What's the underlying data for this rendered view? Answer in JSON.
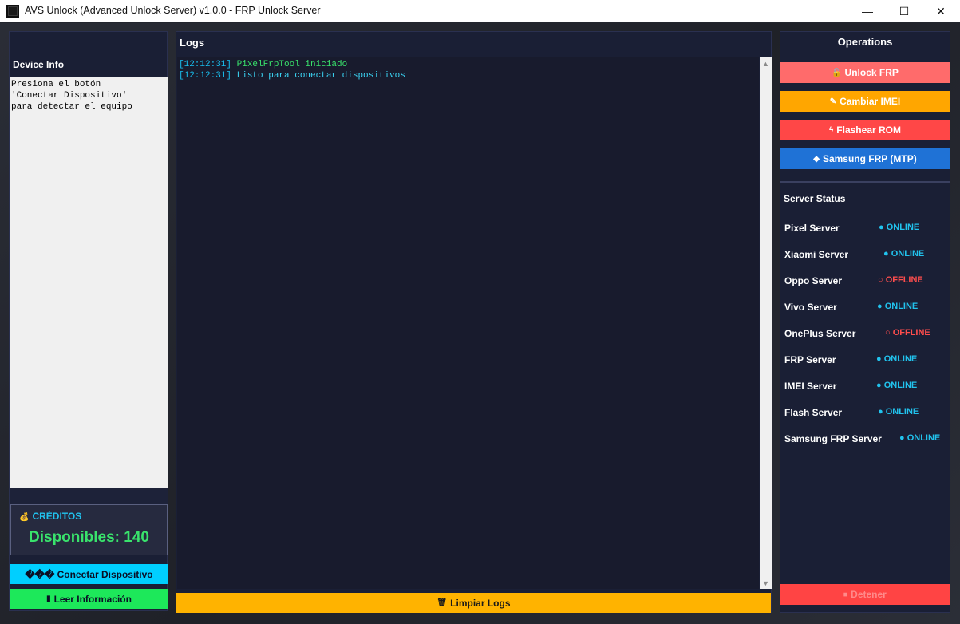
{
  "window": {
    "title": "AVS Unlock (Advanced Unlock Server) v1.0.0 - FRP Unlock Server",
    "minimize": "—",
    "maximize": "☐",
    "close": "✕"
  },
  "left": {
    "device_info_label": "Device Info",
    "device_text": "Presiona el botón\n'Conectar Dispositivo'\npara detectar el equipo",
    "credits_label": "CRÉDITOS",
    "credits_icon": "💰",
    "credits_value": "Disponibles: 140",
    "connect_button": "��� Conectar Dispositivo",
    "read_button": "Leer Información",
    "read_icon": "▮"
  },
  "logs": {
    "title": "Logs",
    "lines": [
      {
        "time": "[12:12:31]",
        "message": " PixelFrpTool iniciado"
      },
      {
        "time": "[12:12:31]",
        "message": " Listo para conectar dispositivos"
      }
    ],
    "clear_button": "Limpiar Logs",
    "clear_icon": "🗑",
    "scroll_up": "▲",
    "scroll_down": "▼"
  },
  "operations": {
    "title": "Operations",
    "buttons": [
      {
        "label": "Unlock FRP",
        "icon": "🔓",
        "color": "#ff6b6b"
      },
      {
        "label": "Cambiar IMEI",
        "icon": "✎",
        "color": "#ffa600"
      },
      {
        "label": "Flashear ROM",
        "icon": "ϟ",
        "color": "#ff4747"
      },
      {
        "label": "Samsung FRP (MTP)",
        "icon": "◆",
        "color": "#1f72d6"
      }
    ],
    "server_status_title": "Server Status",
    "servers": [
      {
        "name": "Pixel Server",
        "status": "● ONLINE"
      },
      {
        "name": "Xiaomi Server",
        "status": "● ONLINE"
      },
      {
        "name": "Oppo Server",
        "status": "○ OFFLINE"
      },
      {
        "name": "Vivo Server",
        "status": "● ONLINE"
      },
      {
        "name": "OnePlus Server",
        "status": "○ OFFLINE"
      },
      {
        "name": "FRP Server",
        "status": "● ONLINE"
      },
      {
        "name": "IMEI Server",
        "status": "● ONLINE"
      },
      {
        "name": "Flash Server",
        "status": "● ONLINE"
      },
      {
        "name": "Samsung FRP Server",
        "status": "● ONLINE"
      }
    ],
    "stop_button": "Detener",
    "stop_icon": "⏹"
  }
}
